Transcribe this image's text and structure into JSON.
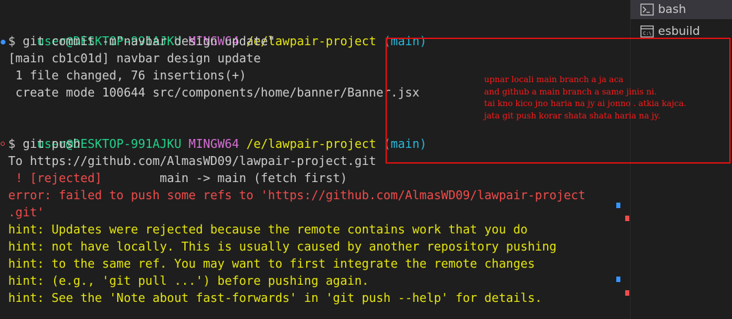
{
  "terminal": {
    "prompt1": {
      "user_host": "user@DESKTOP-991AJKU",
      "env": "MINGW64",
      "path": "/e/lawpair-project",
      "branch": "(main)"
    },
    "cmd1": "$ git commit -m\"navbar design update\"",
    "out1": [
      "[main cb1c01d] navbar design update",
      " 1 file changed, 76 insertions(+)",
      " create mode 100644 src/components/home/banner/Banner.jsx"
    ],
    "prompt2": {
      "user_host": "user@DESKTOP-991AJKU",
      "env": "MINGW64",
      "path": "/e/lawpair-project",
      "branch": "(main)"
    },
    "cmd2": "$ git push",
    "push_to": "To https://github.com/AlmasWD09/lawpair-project.git",
    "rejected_tag": " ! [rejected]",
    "rejected_rest": "        main -> main (fetch first)",
    "error_lines": [
      "error: failed to push some refs to 'https://github.com/AlmasWD09/lawpair-project",
      ".git'"
    ],
    "hint_lines": [
      "hint: Updates were rejected because the remote contains work that you do",
      "hint: not have locally. This is usually caused by another repository pushing",
      "hint: to the same ref. You may want to first integrate the remote changes",
      "hint: (e.g., 'git pull ...') before pushing again.",
      "hint: See the 'Note about fast-forwards' in 'git push --help' for details."
    ]
  },
  "shells": [
    {
      "label": "bash",
      "icon": "terminal-icon"
    },
    {
      "label": "esbuild",
      "icon": "cmd-icon"
    }
  ],
  "annotation": {
    "lines": [
      "upnar locali main branch a ja aca",
      "and github a main branch a same jinis ni.",
      "tai kno kico jno haria na jy ai jonno . atkia kajca.",
      "jata git push korar shata shata haria na jy."
    ],
    "color": "#ff1a1a"
  },
  "colors": {
    "background": "#1e1e1e",
    "user_host": "#23d18b",
    "env": "#d670d6",
    "path": "#e5e510",
    "branch": "#29b8db",
    "error": "#f14c4c",
    "hint": "#e5e510"
  }
}
